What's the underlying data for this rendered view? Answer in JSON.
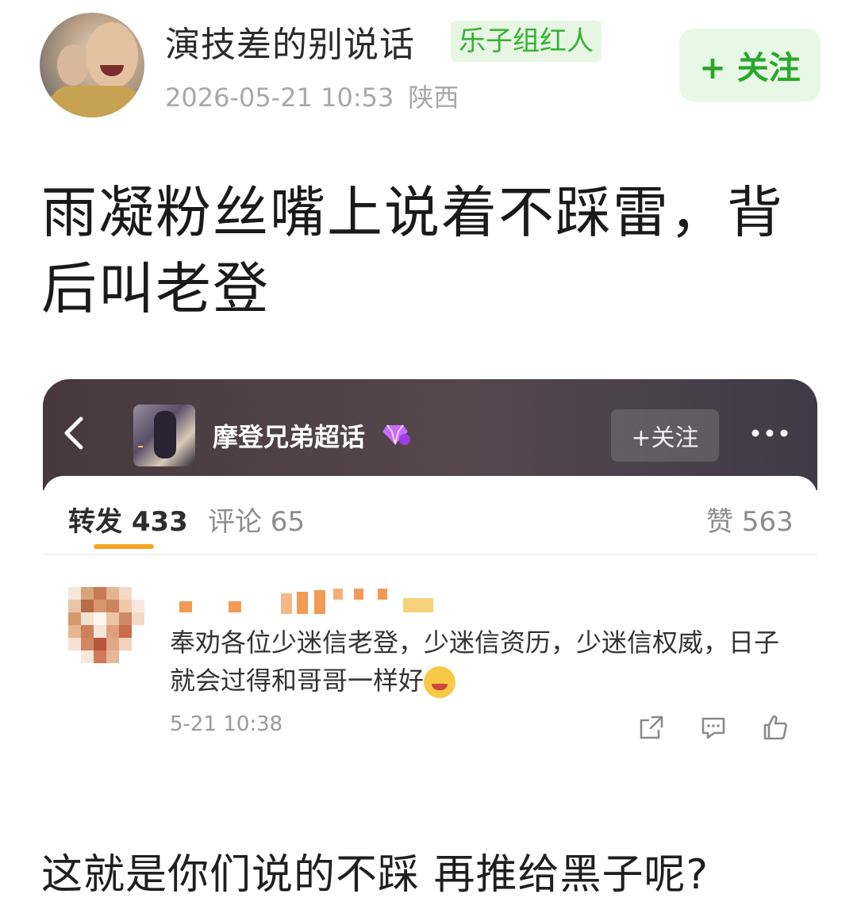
{
  "post": {
    "author": "演技差的别说话",
    "badge": "乐子组红人",
    "date": "2026-05-21 10:53",
    "location": "陕西",
    "follow_label": "+ 关注",
    "text": "雨凝粉丝嘴上说着不踩雷，背后叫老登",
    "caption": "这就是你们说的不踩 再推给黑子呢?"
  },
  "embedded": {
    "back_icon": "chevron-left-icon",
    "topic_title": "摩登兄弟超话",
    "follow_label": "+关注",
    "more_icon": "more-dots-icon",
    "tabs": {
      "repost": "转发 433",
      "comments": "评论 65",
      "likes": "赞 563"
    },
    "comment": {
      "text": "奉劝各位少迷信老登，少迷信资历，少迷信权威，日子就会过得和哥哥一样好",
      "time": "5-21 10:38"
    }
  },
  "colors": {
    "follow_green": "#2aa72a",
    "badge_green": "#34b233",
    "tab_underline": "#f5a623",
    "card_header": "#4a3c42"
  }
}
